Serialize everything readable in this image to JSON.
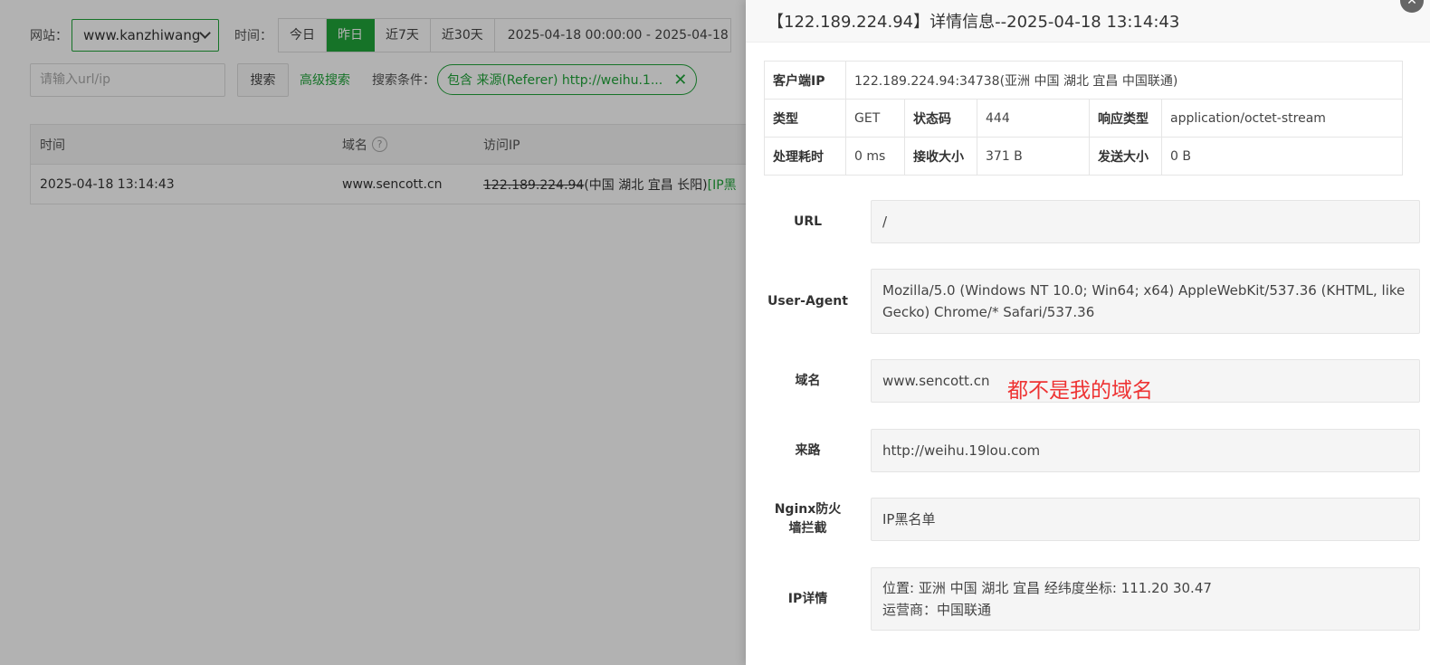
{
  "filters": {
    "site_label": "网站：",
    "site_value": "www.kanzhiwang",
    "time_label": "时间：",
    "time_buttons": [
      "今日",
      "昨日",
      "近7天",
      "近30天"
    ],
    "date_range": "2025-04-18 00:00:00 - 2025-04-18 2"
  },
  "search": {
    "placeholder": "请输入url/ip",
    "button": "搜索",
    "advanced": "高级搜索",
    "cond_label": "搜索条件：",
    "cond_tag": "包含 来源(Referer) http://weihu.1...",
    "cond_close": "✕"
  },
  "log_table": {
    "headers": [
      "时间",
      "域名",
      "访问IP"
    ],
    "help": "?",
    "row": {
      "time": "2025-04-18 13:14:43",
      "domain": "www.sencott.cn",
      "ip": "122.189.224.94",
      "ip_loc": "(中国 湖北 宜昌 长阳)",
      "ip_tag": "[IP黑"
    }
  },
  "drawer": {
    "title": "【122.189.224.94】详情信息--2025-04-18 13:14:43",
    "close": "✕",
    "info": {
      "client_ip_label": "客户端IP",
      "client_ip": "122.189.224.94:34738(亚洲 中国 湖北 宜昌 中国联通)",
      "type_label": "类型",
      "type": "GET",
      "status_label": "状态码",
      "status": "444",
      "resp_type_label": "响应类型",
      "resp_type": "application/octet-stream",
      "time_cost_label": "处理耗时",
      "time_cost": "0 ms",
      "recv_label": "接收大小",
      "recv": "371 B",
      "send_label": "发送大小",
      "send": "0 B"
    },
    "fields": {
      "url_label": "URL",
      "url": "/",
      "ua_label": "User-Agent",
      "ua": "Mozilla/5.0 (Windows NT 10.0; Win64; x64) AppleWebKit/537.36 (KHTML, like Gecko) Chrome/* Safari/537.36",
      "domain_label": "域名",
      "domain": "www.sencott.cn",
      "referer_label": "来路",
      "referer": "http://weihu.19lou.com",
      "waf_label_1": "Nginx防火",
      "waf_label_2": "墙拦截",
      "waf": "IP黑名单",
      "ipinfo_label": "IP详情",
      "ipinfo_line1": "位置: 亚洲 中国 湖北 宜昌 经纬度坐标: 111.20 30.47",
      "ipinfo_line2": "运营商：中国联通"
    },
    "annotation": "都不是我的域名"
  },
  "colors": {
    "accent": "#20a53a",
    "annotation": "#ee3333"
  }
}
